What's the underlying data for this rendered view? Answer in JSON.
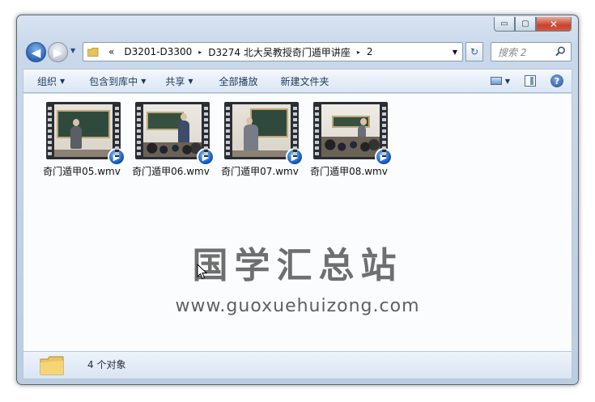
{
  "window": {
    "minimize_glyph": "▭",
    "maximize_glyph": "▢",
    "close_glyph": "✕"
  },
  "nav": {
    "back_glyph": "◀",
    "forward_glyph": "▶",
    "history_glyph": "▼"
  },
  "address": {
    "overflow": "«",
    "crumbs": [
      "D3201-D3300",
      "D3274 北大吴教授奇门遁甲讲座",
      "2"
    ],
    "separator": "▸",
    "dropdown_glyph": "▼",
    "refresh_glyph": "↻"
  },
  "search": {
    "placeholder": "搜索 2",
    "icon": "search-icon"
  },
  "toolbar": {
    "organize": "组织",
    "include_in_library": "包含到库中",
    "share": "共享",
    "play_all": "全部播放",
    "new_folder": "新建文件夹",
    "dropdown_glyph": "▼",
    "help_glyph": "?"
  },
  "files": [
    {
      "name": "奇门遁甲05.wmv"
    },
    {
      "name": "奇门遁甲06.wmv"
    },
    {
      "name": "奇门遁甲07.wmv"
    },
    {
      "name": "奇门遁甲08.wmv"
    }
  ],
  "watermark": {
    "chinese": "国学汇总站",
    "url": "www.guoxuehuizong.com"
  },
  "details": {
    "count_text": "4 个对象"
  },
  "colors": {
    "accent": "#1e395b",
    "window_frame": "#c9d8ea",
    "close_button": "#c7432d"
  }
}
